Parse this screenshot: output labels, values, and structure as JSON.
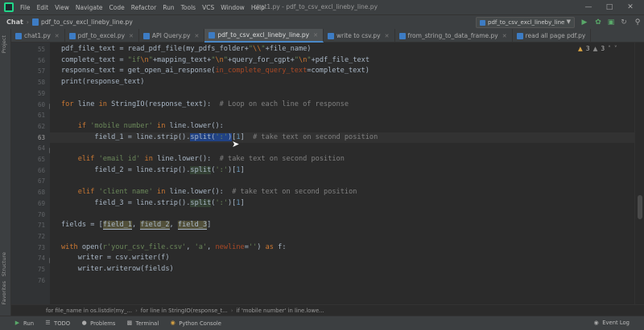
{
  "menubar": {
    "items": [
      "File",
      "Edit",
      "View",
      "Navigate",
      "Code",
      "Refactor",
      "Run",
      "Tools",
      "VCS",
      "Window",
      "Help"
    ],
    "window_title": "chat1.py - pdf_to_csv_excl_lineby_line.py"
  },
  "navbar": {
    "project": "Chat",
    "file": "pdf_to_csv_excl_lineby_line.py",
    "run_config": "pdf_to_csv_excl_lineby_line"
  },
  "tabs": [
    {
      "label": "chat1.py",
      "active": false
    },
    {
      "label": "pdf_to_excel.py",
      "active": false
    },
    {
      "label": "API Query.py",
      "active": false
    },
    {
      "label": "pdf_to_csv_excl_lineby_line.py",
      "active": true
    },
    {
      "label": "write to csv.py",
      "active": false
    },
    {
      "label": "from_string_to_data_frame.py",
      "active": false
    },
    {
      "label": "read all page pdf.py",
      "active": false
    }
  ],
  "side_tabs": {
    "project": "Project",
    "structure": "Structure",
    "favorites": "Favorites"
  },
  "inspection": {
    "warnings": "3",
    "weak_warnings": "3"
  },
  "line_numbers": [
    "55",
    "56",
    "57",
    "58",
    "59",
    "60",
    "61",
    "62",
    "63",
    "64",
    "65",
    "66",
    "67",
    "68",
    "69",
    "70",
    "71",
    "72",
    "73",
    "74",
    "75",
    "76"
  ],
  "current_line": "63",
  "breadcrumbs": [
    "for file_name in os.listdir(my_...",
    "for line in StringIO(response_t...",
    "if 'mobile number' in line.lowe..."
  ],
  "bottom_bar": {
    "run": "Run",
    "todo": "TODO",
    "problems": "Problems",
    "terminal": "Terminal",
    "python_console": "Python Console",
    "event_log": "Event Log"
  },
  "colors": {
    "keyword": "#cc7832",
    "string": "#6a8759",
    "comment": "#808080",
    "selection": "#214283",
    "accent": "#4a88c7"
  }
}
